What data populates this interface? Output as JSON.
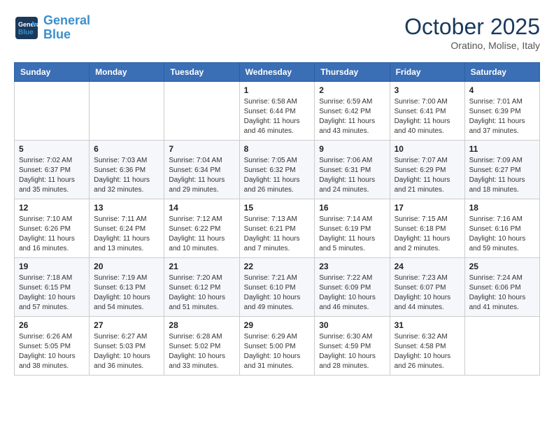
{
  "header": {
    "logo_line1": "General",
    "logo_line2": "Blue",
    "month": "October 2025",
    "location": "Oratino, Molise, Italy"
  },
  "days_of_week": [
    "Sunday",
    "Monday",
    "Tuesday",
    "Wednesday",
    "Thursday",
    "Friday",
    "Saturday"
  ],
  "weeks": [
    [
      {
        "day": "",
        "info": ""
      },
      {
        "day": "",
        "info": ""
      },
      {
        "day": "",
        "info": ""
      },
      {
        "day": "1",
        "info": "Sunrise: 6:58 AM\nSunset: 6:44 PM\nDaylight: 11 hours\nand 46 minutes."
      },
      {
        "day": "2",
        "info": "Sunrise: 6:59 AM\nSunset: 6:42 PM\nDaylight: 11 hours\nand 43 minutes."
      },
      {
        "day": "3",
        "info": "Sunrise: 7:00 AM\nSunset: 6:41 PM\nDaylight: 11 hours\nand 40 minutes."
      },
      {
        "day": "4",
        "info": "Sunrise: 7:01 AM\nSunset: 6:39 PM\nDaylight: 11 hours\nand 37 minutes."
      }
    ],
    [
      {
        "day": "5",
        "info": "Sunrise: 7:02 AM\nSunset: 6:37 PM\nDaylight: 11 hours\nand 35 minutes."
      },
      {
        "day": "6",
        "info": "Sunrise: 7:03 AM\nSunset: 6:36 PM\nDaylight: 11 hours\nand 32 minutes."
      },
      {
        "day": "7",
        "info": "Sunrise: 7:04 AM\nSunset: 6:34 PM\nDaylight: 11 hours\nand 29 minutes."
      },
      {
        "day": "8",
        "info": "Sunrise: 7:05 AM\nSunset: 6:32 PM\nDaylight: 11 hours\nand 26 minutes."
      },
      {
        "day": "9",
        "info": "Sunrise: 7:06 AM\nSunset: 6:31 PM\nDaylight: 11 hours\nand 24 minutes."
      },
      {
        "day": "10",
        "info": "Sunrise: 7:07 AM\nSunset: 6:29 PM\nDaylight: 11 hours\nand 21 minutes."
      },
      {
        "day": "11",
        "info": "Sunrise: 7:09 AM\nSunset: 6:27 PM\nDaylight: 11 hours\nand 18 minutes."
      }
    ],
    [
      {
        "day": "12",
        "info": "Sunrise: 7:10 AM\nSunset: 6:26 PM\nDaylight: 11 hours\nand 16 minutes."
      },
      {
        "day": "13",
        "info": "Sunrise: 7:11 AM\nSunset: 6:24 PM\nDaylight: 11 hours\nand 13 minutes."
      },
      {
        "day": "14",
        "info": "Sunrise: 7:12 AM\nSunset: 6:22 PM\nDaylight: 11 hours\nand 10 minutes."
      },
      {
        "day": "15",
        "info": "Sunrise: 7:13 AM\nSunset: 6:21 PM\nDaylight: 11 hours\nand 7 minutes."
      },
      {
        "day": "16",
        "info": "Sunrise: 7:14 AM\nSunset: 6:19 PM\nDaylight: 11 hours\nand 5 minutes."
      },
      {
        "day": "17",
        "info": "Sunrise: 7:15 AM\nSunset: 6:18 PM\nDaylight: 11 hours\nand 2 minutes."
      },
      {
        "day": "18",
        "info": "Sunrise: 7:16 AM\nSunset: 6:16 PM\nDaylight: 10 hours\nand 59 minutes."
      }
    ],
    [
      {
        "day": "19",
        "info": "Sunrise: 7:18 AM\nSunset: 6:15 PM\nDaylight: 10 hours\nand 57 minutes."
      },
      {
        "day": "20",
        "info": "Sunrise: 7:19 AM\nSunset: 6:13 PM\nDaylight: 10 hours\nand 54 minutes."
      },
      {
        "day": "21",
        "info": "Sunrise: 7:20 AM\nSunset: 6:12 PM\nDaylight: 10 hours\nand 51 minutes."
      },
      {
        "day": "22",
        "info": "Sunrise: 7:21 AM\nSunset: 6:10 PM\nDaylight: 10 hours\nand 49 minutes."
      },
      {
        "day": "23",
        "info": "Sunrise: 7:22 AM\nSunset: 6:09 PM\nDaylight: 10 hours\nand 46 minutes."
      },
      {
        "day": "24",
        "info": "Sunrise: 7:23 AM\nSunset: 6:07 PM\nDaylight: 10 hours\nand 44 minutes."
      },
      {
        "day": "25",
        "info": "Sunrise: 7:24 AM\nSunset: 6:06 PM\nDaylight: 10 hours\nand 41 minutes."
      }
    ],
    [
      {
        "day": "26",
        "info": "Sunrise: 6:26 AM\nSunset: 5:05 PM\nDaylight: 10 hours\nand 38 minutes."
      },
      {
        "day": "27",
        "info": "Sunrise: 6:27 AM\nSunset: 5:03 PM\nDaylight: 10 hours\nand 36 minutes."
      },
      {
        "day": "28",
        "info": "Sunrise: 6:28 AM\nSunset: 5:02 PM\nDaylight: 10 hours\nand 33 minutes."
      },
      {
        "day": "29",
        "info": "Sunrise: 6:29 AM\nSunset: 5:00 PM\nDaylight: 10 hours\nand 31 minutes."
      },
      {
        "day": "30",
        "info": "Sunrise: 6:30 AM\nSunset: 4:59 PM\nDaylight: 10 hours\nand 28 minutes."
      },
      {
        "day": "31",
        "info": "Sunrise: 6:32 AM\nSunset: 4:58 PM\nDaylight: 10 hours\nand 26 minutes."
      },
      {
        "day": "",
        "info": ""
      }
    ]
  ]
}
